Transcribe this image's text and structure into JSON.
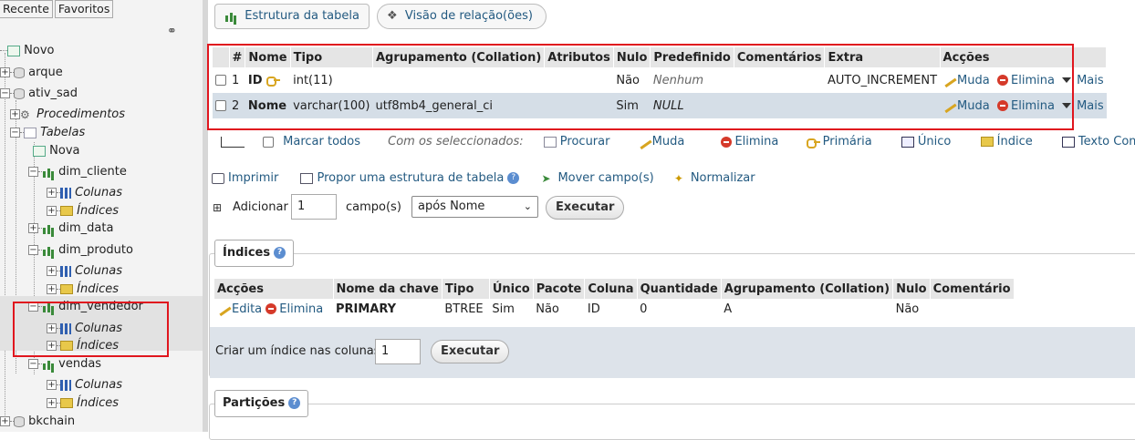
{
  "nav": {
    "tabs": [
      "Recente",
      "Favoritos"
    ],
    "tree": [
      {
        "label": "Novo",
        "italic": false
      },
      {
        "label": "arque",
        "italic": false
      },
      {
        "label": "ativ_sad",
        "italic": false
      },
      {
        "label": "Procedimentos",
        "italic": true
      },
      {
        "label": "Tabelas",
        "italic": true
      },
      {
        "label": "Nova",
        "italic": false
      },
      {
        "label": "dim_cliente",
        "italic": false
      },
      {
        "label": "Colunas",
        "italic": true
      },
      {
        "label": "Índices",
        "italic": true
      },
      {
        "label": "dim_data",
        "italic": false
      },
      {
        "label": "dim_produto",
        "italic": false
      },
      {
        "label": "Colunas",
        "italic": true
      },
      {
        "label": "Índices",
        "italic": true
      },
      {
        "label": "dim_vendedor",
        "italic": false
      },
      {
        "label": "Colunas",
        "italic": true
      },
      {
        "label": "Índices",
        "italic": true
      },
      {
        "label": "vendas",
        "italic": false
      },
      {
        "label": "Colunas",
        "italic": true
      },
      {
        "label": "Índices",
        "italic": true
      },
      {
        "label": "bkchain",
        "italic": false
      }
    ]
  },
  "top": {
    "structure_label": "Estrutura da tabela",
    "relation_label": "Visão de relação(ões)"
  },
  "columns_table": {
    "headers": [
      "#",
      "Nome",
      "Tipo",
      "Agrupamento (Collation)",
      "Atributos",
      "Nulo",
      "Predefinido",
      "Comentários",
      "Extra",
      "Acções"
    ],
    "rows": [
      {
        "num": "1",
        "name": "ID",
        "type": "int(11)",
        "collation": "",
        "attributes": "",
        "null": "Não",
        "default": "Nenhum",
        "comments": "",
        "extra": "AUTO_INCREMENT",
        "change": "Muda",
        "drop": "Elimina",
        "more": "Mais"
      },
      {
        "num": "2",
        "name": "Nome",
        "type": "varchar(100)",
        "collation": "utf8mb4_general_ci",
        "attributes": "",
        "null": "Sim",
        "default": "NULL",
        "comments": "",
        "extra": "",
        "change": "Muda",
        "drop": "Elimina",
        "more": "Mais"
      }
    ]
  },
  "bulk": {
    "check_all": "Marcar todos",
    "with_selected": "Com os seleccionados:",
    "browse": "Procurar",
    "change": "Muda",
    "drop": "Elimina",
    "primary": "Primária",
    "unique": "Único",
    "index": "Índice",
    "fulltext": "Texto Completo"
  },
  "tools": {
    "print": "Imprimir",
    "propose": "Propor uma estrutura de tabela",
    "move": "Mover campo(s)",
    "normalize": "Normalizar"
  },
  "add_fields": {
    "label": "Adicionar",
    "count": "1",
    "unit": "campo(s)",
    "position": "após Nome",
    "go": "Executar"
  },
  "indexes": {
    "legend": "Índices",
    "headers": [
      "Acções",
      "Nome da chave",
      "Tipo",
      "Único",
      "Pacote",
      "Coluna",
      "Quantidade",
      "Agrupamento (Collation)",
      "Nulo",
      "Comentário"
    ],
    "rows": [
      {
        "edit": "Edita",
        "drop": "Elimina",
        "key": "PRIMARY",
        "type": "BTREE",
        "unique": "Sim",
        "packed": "Não",
        "column": "ID",
        "cardinality": "0",
        "collation": "A",
        "null": "Não",
        "comment": ""
      }
    ],
    "create_label": "Criar um índice nas colunas",
    "create_count": "1",
    "go": "Executar"
  },
  "partitions": {
    "legend": "Partições"
  },
  "colors": {
    "link": "#235a81",
    "highlight_box": "#e0161e",
    "row_selected": "#d5dee7"
  }
}
